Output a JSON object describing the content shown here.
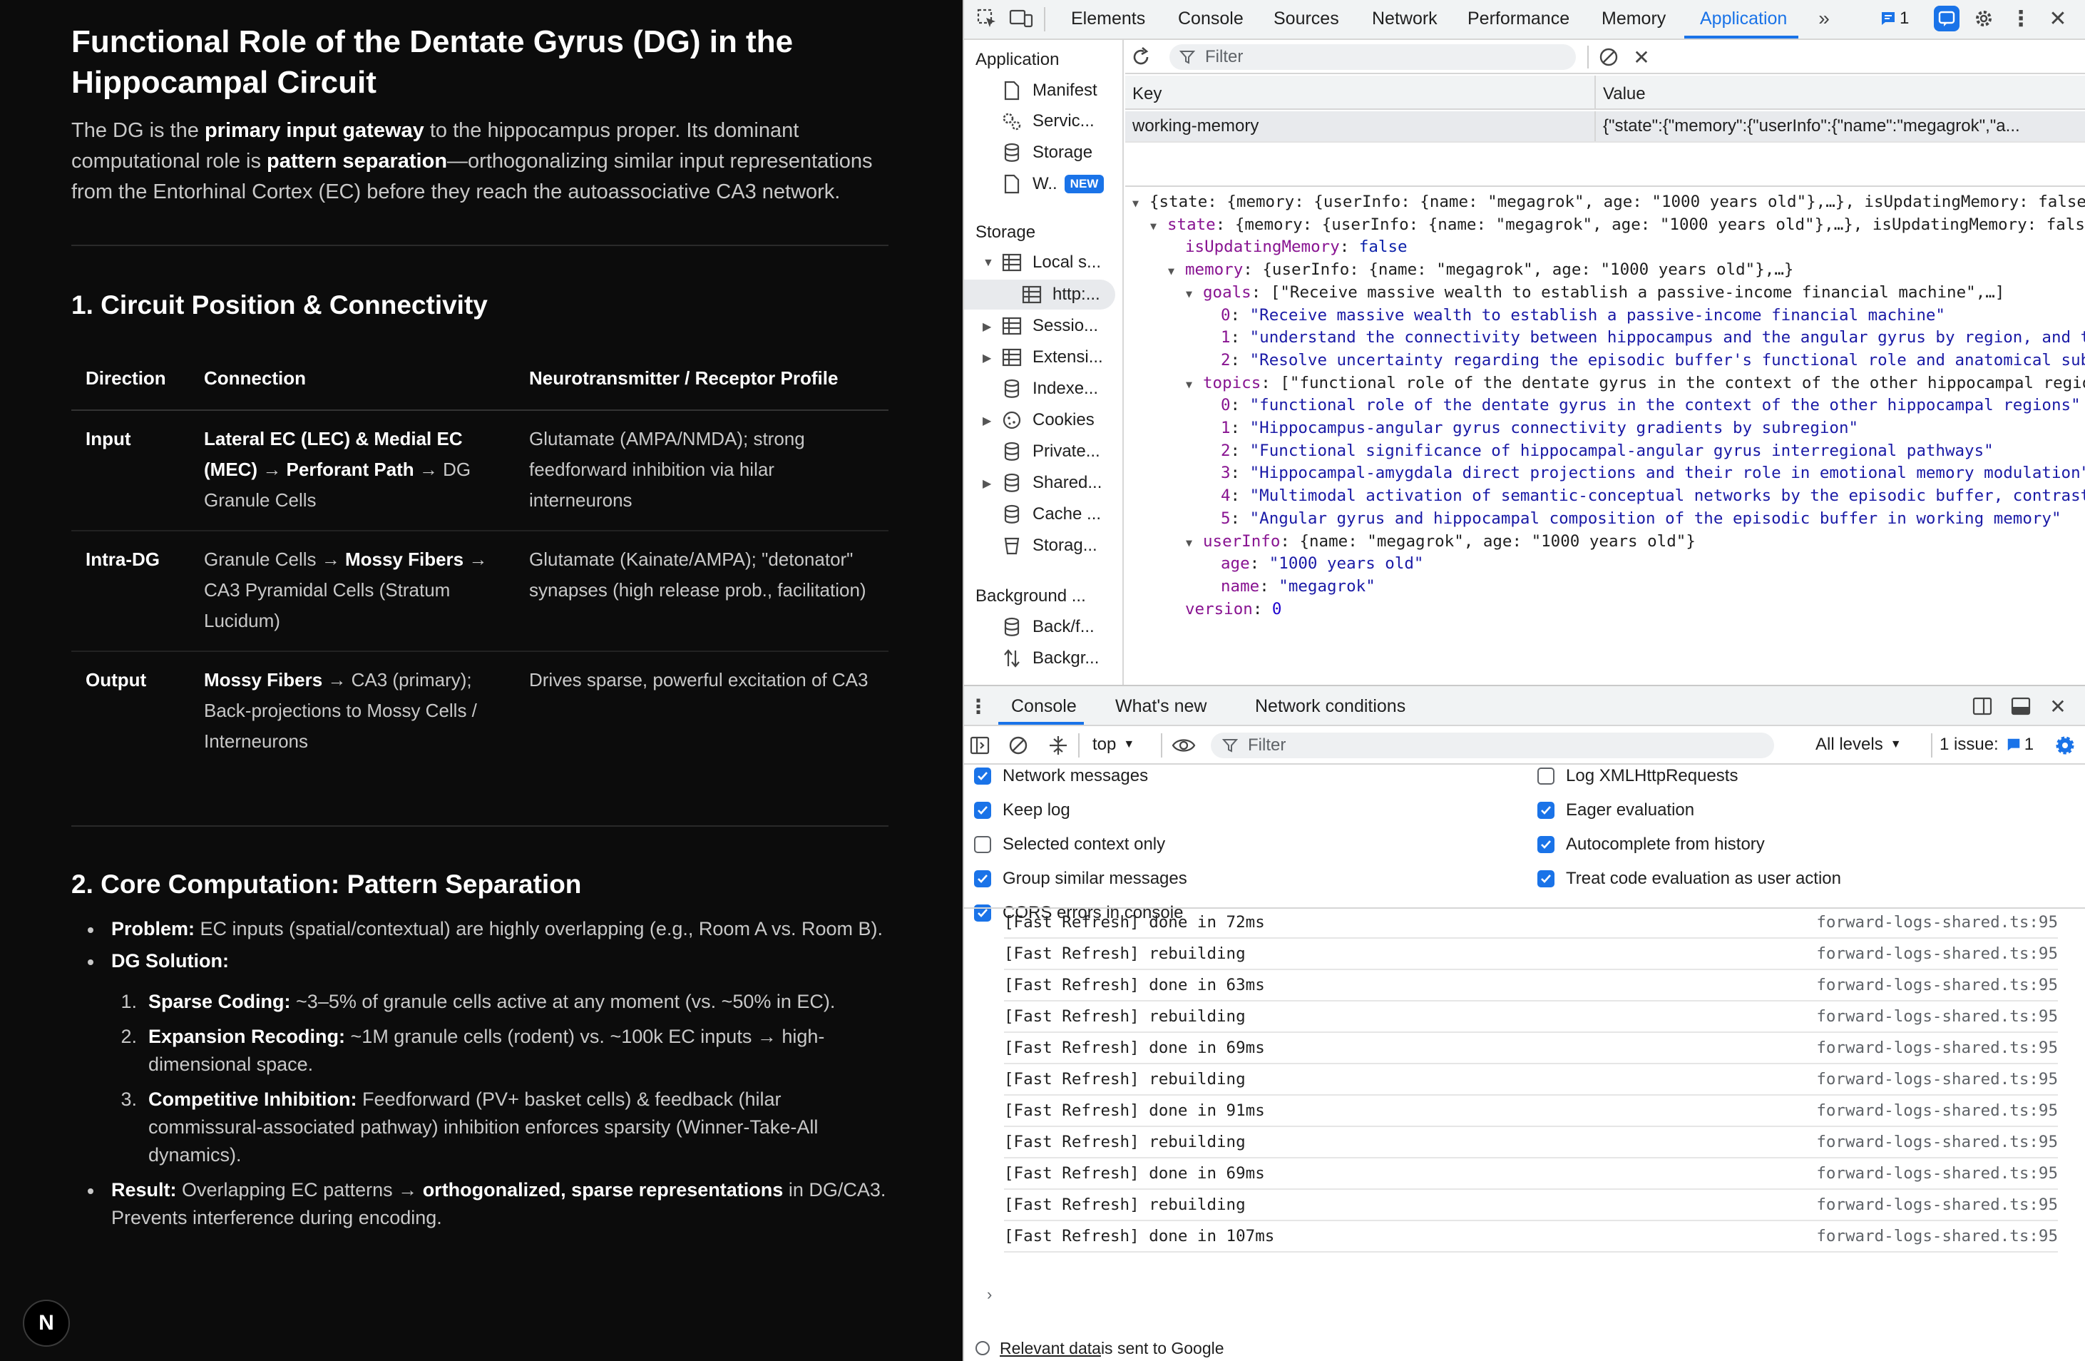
{
  "article": {
    "title": "Functional Role of the Dentate Gyrus (DG) in the Hippocampal Circuit",
    "intro": {
      "p1": "The DG is the ",
      "b1": "primary input gateway",
      "p2": " to the hippocampus proper. Its dominant computational role is ",
      "b2": "pattern separation",
      "p3": "—orthogonalizing similar input representations from the Entorhinal Cortex (EC) before they reach the autoassociative CA3 network."
    },
    "section1": {
      "heading": "1. Circuit Position & Connectivity",
      "headers": [
        "Direction",
        "Connection",
        "Neurotransmitter / Receptor Profile"
      ],
      "rows": [
        {
          "dir": "Input",
          "c_b1": "Lateral EC (LEC) & Medial EC (MEC)",
          "c_t1": " → ",
          "c_b2": "Perforant Path",
          "c_t2": " → DG Granule Cells",
          "nt": "Glutamate (AMPA/NMDA); strong feedforward inhibition via hilar interneurons"
        },
        {
          "dir": "Intra-DG",
          "c_t0": "Granule Cells → ",
          "c_b1": "Mossy Fibers",
          "c_t1": " → CA3 Pyramidal Cells (Stratum Lucidum)",
          "nt": "Glutamate (Kainate/AMPA); \"detonator\" synapses (high release prob., facilitation)"
        },
        {
          "dir": "Output",
          "c_b1": "Mossy Fibers",
          "c_t1": " → CA3 (primary); Back-projections to Mossy Cells / Interneurons",
          "nt": "Drives sparse, powerful excitation of CA3"
        }
      ]
    },
    "section2": {
      "heading": "2. Core Computation: Pattern Separation",
      "problem_label": "Problem:",
      "problem_text": " EC inputs (spatial/contextual) are highly overlapping (e.g., Room A vs. Room B).",
      "solution_label": "DG Solution:",
      "steps": [
        {
          "num": "1.",
          "label": "Sparse Coding:",
          "text": " ~3–5% of granule cells active at any moment (vs. ~50% in EC)."
        },
        {
          "num": "2.",
          "label": "Expansion Recoding:",
          "text": " ~1M granule cells (rodent) vs. ~100k EC inputs → high-dimensional space."
        },
        {
          "num": "3.",
          "label": "Competitive Inhibition:",
          "text": " Feedforward (PV+ basket cells) & feedback (hilar commissural-associated pathway) inhibition enforces sparsity (Winner-Take-All dynamics)."
        }
      ],
      "result_label": "Result:",
      "result_t1": " Overlapping EC patterns → ",
      "result_b": "orthogonalized, sparse representations",
      "result_t2": " in DG/CA3. Prevents interference during encoding."
    },
    "logo_letter": "N"
  },
  "devtools": {
    "tabs": [
      "Elements",
      "Console",
      "Sources",
      "Network",
      "Performance",
      "Memory",
      "Application"
    ],
    "active_tab": "Application",
    "issues_count": "1",
    "sidebar": {
      "application_header": "Application",
      "application_items": [
        "Manifest",
        "Servic...",
        "Storage",
        "W.."
      ],
      "new_badge": "NEW",
      "storage_header": "Storage",
      "storage_items": [
        "Local s...",
        "http:...",
        "Sessio...",
        "Extensi...",
        "Indexe...",
        "Cookies",
        "Private...",
        "Shared...",
        "Cache ...",
        "Storag..."
      ],
      "background_header": "Background ...",
      "background_items": [
        "Back/f...",
        "Backgr..."
      ]
    },
    "filter_placeholder": "Filter",
    "kv": {
      "key_header": "Key",
      "value_header": "Value",
      "row_key": "working-memory",
      "row_value": "{\"state\":{\"memory\":{\"userInfo\":{\"name\":\"megagrok\",\"a..."
    },
    "tree": [
      {
        "indent": 0,
        "arrow": "down",
        "parts": [
          [
            "p",
            "{state: {memory: {userInfo: {name: \"megagrok\", age: \"1000 years old\"},…}, isUpdatingMemory: false}"
          ]
        ]
      },
      {
        "indent": 1,
        "arrow": "down",
        "parts": [
          [
            "k",
            "state"
          ],
          [
            "p",
            ": {memory: {userInfo: {name: \"megagrok\", age: \"1000 years old\"},…}, isUpdatingMemory: false}"
          ]
        ]
      },
      {
        "indent": 2,
        "arrow": "none",
        "parts": [
          [
            "k",
            "isUpdatingMemory"
          ],
          [
            "p",
            ": "
          ],
          [
            "b",
            "false"
          ]
        ]
      },
      {
        "indent": 2,
        "arrow": "down",
        "parts": [
          [
            "k",
            "memory"
          ],
          [
            "p",
            ": {userInfo: {name: \"megagrok\", age: \"1000 years old\"},…}"
          ]
        ]
      },
      {
        "indent": 3,
        "arrow": "down",
        "parts": [
          [
            "k",
            "goals"
          ],
          [
            "p",
            ": [\"Receive massive wealth to establish a passive-income financial machine\",…]"
          ]
        ]
      },
      {
        "indent": 4,
        "arrow": "none",
        "parts": [
          [
            "k",
            "0"
          ],
          [
            "p",
            ": "
          ],
          [
            "s",
            "\"Receive massive wealth to establish a passive-income financial machine\""
          ]
        ]
      },
      {
        "indent": 4,
        "arrow": "none",
        "parts": [
          [
            "k",
            "1"
          ],
          [
            "p",
            ": "
          ],
          [
            "s",
            "\"understand the connectivity between hippocampus and the angular gyrus by region, and to"
          ]
        ]
      },
      {
        "indent": 4,
        "arrow": "none",
        "parts": [
          [
            "k",
            "2"
          ],
          [
            "p",
            ": "
          ],
          [
            "s",
            "\"Resolve uncertainty regarding the episodic buffer's functional role and anatomical subs"
          ]
        ]
      },
      {
        "indent": 3,
        "arrow": "down",
        "parts": [
          [
            "k",
            "topics"
          ],
          [
            "p",
            ": [\"functional role of the dentate gyrus in the context of the other hippocampal region"
          ]
        ]
      },
      {
        "indent": 4,
        "arrow": "none",
        "parts": [
          [
            "k",
            "0"
          ],
          [
            "p",
            ": "
          ],
          [
            "s",
            "\"functional role of the dentate gyrus in the context of the other hippocampal regions\""
          ]
        ]
      },
      {
        "indent": 4,
        "arrow": "none",
        "parts": [
          [
            "k",
            "1"
          ],
          [
            "p",
            ": "
          ],
          [
            "s",
            "\"Hippocampus-angular gyrus connectivity gradients by subregion\""
          ]
        ]
      },
      {
        "indent": 4,
        "arrow": "none",
        "parts": [
          [
            "k",
            "2"
          ],
          [
            "p",
            ": "
          ],
          [
            "s",
            "\"Functional significance of hippocampal-angular gyrus interregional pathways\""
          ]
        ]
      },
      {
        "indent": 4,
        "arrow": "none",
        "parts": [
          [
            "k",
            "3"
          ],
          [
            "p",
            ": "
          ],
          [
            "s",
            "\"Hippocampal-amygdala direct projections and their role in emotional memory modulation\""
          ]
        ]
      },
      {
        "indent": 4,
        "arrow": "none",
        "parts": [
          [
            "k",
            "4"
          ],
          [
            "p",
            ": "
          ],
          [
            "s",
            "\"Multimodal activation of semantic-conceptual networks by the episodic buffer, contrasti"
          ]
        ]
      },
      {
        "indent": 4,
        "arrow": "none",
        "parts": [
          [
            "k",
            "5"
          ],
          [
            "p",
            ": "
          ],
          [
            "s",
            "\"Angular gyrus and hippocampal composition of the episodic buffer in working memory\""
          ]
        ]
      },
      {
        "indent": 3,
        "arrow": "down",
        "parts": [
          [
            "k",
            "userInfo"
          ],
          [
            "p",
            ": {name: \"megagrok\", age: \"1000 years old\"}"
          ]
        ]
      },
      {
        "indent": 4,
        "arrow": "none",
        "parts": [
          [
            "k",
            "age"
          ],
          [
            "p",
            ": "
          ],
          [
            "s",
            "\"1000 years old\""
          ]
        ]
      },
      {
        "indent": 4,
        "arrow": "none",
        "parts": [
          [
            "k",
            "name"
          ],
          [
            "p",
            ": "
          ],
          [
            "s",
            "\"megagrok\""
          ]
        ]
      },
      {
        "indent": 2,
        "arrow": "none",
        "parts": [
          [
            "k",
            "version"
          ],
          [
            "p",
            ": "
          ],
          [
            "n",
            "0"
          ]
        ]
      }
    ],
    "drawer": {
      "tabs": [
        "Console",
        "What's new",
        "Network conditions"
      ],
      "context": "top",
      "filter_placeholder": "Filter",
      "levels": "All levels",
      "issues_label": "1 issue:",
      "issues_count": "1",
      "settings_left": [
        {
          "label": "Network messages",
          "checked": true
        },
        {
          "label": "Keep log",
          "checked": true
        },
        {
          "label": "Selected context only",
          "checked": false
        },
        {
          "label": "Group similar messages",
          "checked": true
        },
        {
          "label": "CORS errors in console",
          "checked": true
        }
      ],
      "settings_right": [
        {
          "label": "Log XMLHttpRequests",
          "checked": false
        },
        {
          "label": "Eager evaluation",
          "checked": true
        },
        {
          "label": "Autocomplete from history",
          "checked": true
        },
        {
          "label": "Treat code evaluation as user action",
          "checked": true
        }
      ],
      "logs": [
        {
          "msg": "[Fast Refresh] done in 72ms",
          "src": "forward-logs-shared.ts:95"
        },
        {
          "msg": "[Fast Refresh] rebuilding",
          "src": "forward-logs-shared.ts:95"
        },
        {
          "msg": "[Fast Refresh] done in 63ms",
          "src": "forward-logs-shared.ts:95"
        },
        {
          "msg": "[Fast Refresh] rebuilding",
          "src": "forward-logs-shared.ts:95"
        },
        {
          "msg": "[Fast Refresh] done in 69ms",
          "src": "forward-logs-shared.ts:95"
        },
        {
          "msg": "[Fast Refresh] rebuilding",
          "src": "forward-logs-shared.ts:95"
        },
        {
          "msg": "[Fast Refresh] done in 91ms",
          "src": "forward-logs-shared.ts:95"
        },
        {
          "msg": "[Fast Refresh] rebuilding",
          "src": "forward-logs-shared.ts:95"
        },
        {
          "msg": "[Fast Refresh] done in 69ms",
          "src": "forward-logs-shared.ts:95"
        },
        {
          "msg": "[Fast Refresh] rebuilding",
          "src": "forward-logs-shared.ts:95"
        },
        {
          "msg": "[Fast Refresh] done in 107ms",
          "src": "forward-logs-shared.ts:95"
        }
      ],
      "footer_link": "Relevant data",
      "footer_text": " is sent to Google"
    }
  }
}
